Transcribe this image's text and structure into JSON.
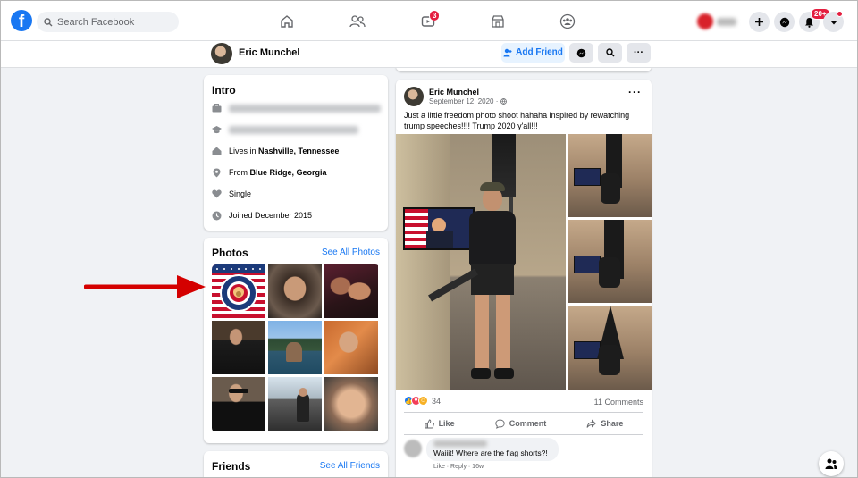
{
  "nav": {
    "logo": "f",
    "search_placeholder": "Search Facebook",
    "video_badge": "3",
    "notifications_badge": "20+"
  },
  "profile_header": {
    "name": "Eric Munchel",
    "add_friend_label": "Add Friend",
    "more_label": "···"
  },
  "intro": {
    "title": "Intro",
    "rows": [
      {
        "icon": "briefcase-icon",
        "prefix": "",
        "bold": "",
        "blurred": true
      },
      {
        "icon": "graduation-cap-icon",
        "prefix": "",
        "bold": "",
        "blurred": true
      },
      {
        "icon": "home-icon",
        "prefix": "Lives in ",
        "bold": "Nashville, Tennessee"
      },
      {
        "icon": "location-pin-icon",
        "prefix": "From ",
        "bold": "Blue Ridge, Georgia"
      },
      {
        "icon": "heart-icon",
        "prefix": "Single",
        "bold": ""
      },
      {
        "icon": "clock-icon",
        "prefix": "Joined December 2015",
        "bold": ""
      }
    ]
  },
  "photos": {
    "title": "Photos",
    "see_all": "See All Photos"
  },
  "friends": {
    "title": "Friends",
    "see_all": "See All Friends"
  },
  "post": {
    "author": "Eric Munchel",
    "date": "September 12, 2020 ·",
    "text": "Just a little freedom photo shoot hahaha inspired by rewatching trump speeches!!!! Trump 2020 y'all!!!",
    "reaction_count": "34",
    "comments_count": "11 Comments",
    "actions": {
      "like": "Like",
      "comment": "Comment",
      "share": "Share"
    },
    "comment_preview": {
      "text": "Waiiit! Where are the flag shorts?!",
      "meta": "Like · Reply · 16w"
    }
  },
  "colors": {
    "brand": "#1877f2",
    "background": "#f0f2f5",
    "badge": "#e41e3f",
    "annotation_arrow": "#d40000"
  }
}
